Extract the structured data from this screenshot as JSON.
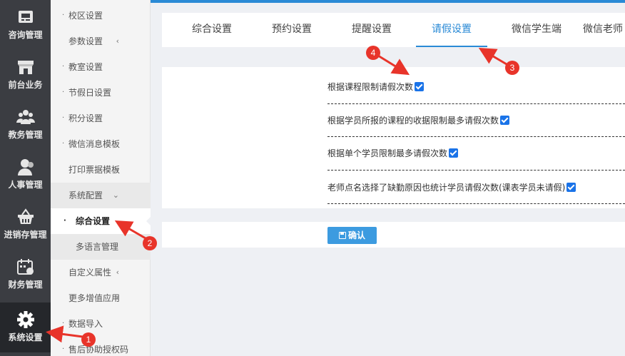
{
  "rail": [
    {
      "label": "咨询管理",
      "icon": "consult-icon"
    },
    {
      "label": "前台业务",
      "icon": "storefront-icon"
    },
    {
      "label": "教务管理",
      "icon": "people-group-icon"
    },
    {
      "label": "人事管理",
      "icon": "person-icon"
    },
    {
      "label": "进销存管理",
      "icon": "basket-icon"
    },
    {
      "label": "财务管理",
      "icon": "calendar-money-icon"
    },
    {
      "label": "系统设置",
      "icon": "gear-icon"
    }
  ],
  "submenu": [
    {
      "label": "校区设置"
    },
    {
      "label": "参数设置",
      "chevron": "‹"
    },
    {
      "label": "教室设置"
    },
    {
      "label": "节假日设置"
    },
    {
      "label": "积分设置"
    },
    {
      "label": "微信消息模板"
    },
    {
      "label": "打印票据模板",
      "chevron": "‹"
    },
    {
      "label": "系统配置",
      "chevron": "⌄"
    },
    {
      "label": "综合设置"
    },
    {
      "label": "多语言管理"
    },
    {
      "label": "自定义属性",
      "chevron": "‹"
    },
    {
      "label": "更多增值应用",
      "chevron": "‹"
    },
    {
      "label": "数据导入"
    },
    {
      "label": "售后协助授权码"
    }
  ],
  "tabs": [
    "综合设置",
    "预约设置",
    "提醒设置",
    "请假设置",
    "微信学生端",
    "微信老师"
  ],
  "options": [
    {
      "label": "根据课程限制请假次数",
      "checked": true
    },
    {
      "label": "根据学员所报的课程的收据限制最多请假次数",
      "checked": true
    },
    {
      "label": "根据单个学员限制最多请假次数",
      "checked": true
    },
    {
      "label": "老师点名选择了缺勤原因也统计学员请假次数(课表学员未请假)",
      "checked": true
    }
  ],
  "confirm_label": "确认",
  "annotations": [
    "1",
    "2",
    "3",
    "4"
  ],
  "colors": {
    "accent": "#2a8ad6",
    "annotation": "#e8342a",
    "rail": "#3b3d42"
  }
}
